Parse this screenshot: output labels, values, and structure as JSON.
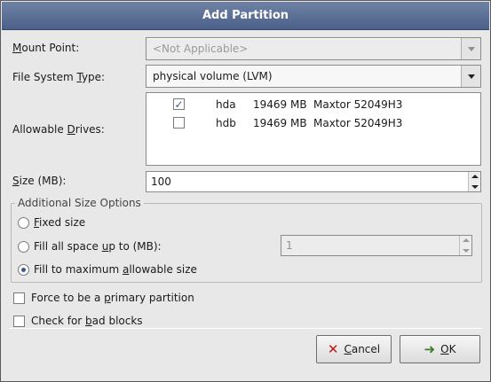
{
  "dialog": {
    "title": "Add Partition"
  },
  "mount_point": {
    "label_pre": "",
    "label_acc": "M",
    "label_post": "ount Point:",
    "value": "<Not Applicable>",
    "disabled": true
  },
  "fs_type": {
    "label_pre": "File System ",
    "label_acc": "T",
    "label_post": "ype:",
    "value": "physical volume (LVM)"
  },
  "allowable_drives": {
    "label_pre": "Allowable ",
    "label_acc": "D",
    "label_post": "rives:",
    "rows": [
      {
        "checked": true,
        "name": "hda",
        "size": "19469 MB",
        "model": "Maxtor 52049H3"
      },
      {
        "checked": false,
        "name": "hdb",
        "size": "19469 MB",
        "model": "Maxtor 52049H3"
      }
    ]
  },
  "size": {
    "label_pre": "",
    "label_acc": "S",
    "label_post": "ize (MB):",
    "value": "100"
  },
  "additional": {
    "title": "Additional Size Options",
    "fixed": {
      "pre": "",
      "acc": "F",
      "post": "ixed size",
      "selected": false
    },
    "fill_up": {
      "pre": "Fill all space ",
      "acc": "u",
      "post": "p to (MB):",
      "selected": false,
      "value": "1"
    },
    "fill_max": {
      "pre": "Fill to maximum ",
      "acc": "a",
      "post": "llowable size",
      "selected": true
    }
  },
  "primary": {
    "pre": "Force to be a ",
    "acc": "p",
    "post": "rimary partition",
    "checked": false
  },
  "badblocks": {
    "pre": "Check for ",
    "acc": "b",
    "post": "ad blocks",
    "checked": false
  },
  "buttons": {
    "cancel": {
      "pre": "",
      "acc": "C",
      "post": "ancel",
      "icon": "cancel-icon"
    },
    "ok": {
      "pre": "",
      "acc": "O",
      "post": "K",
      "icon": "ok-icon"
    }
  }
}
